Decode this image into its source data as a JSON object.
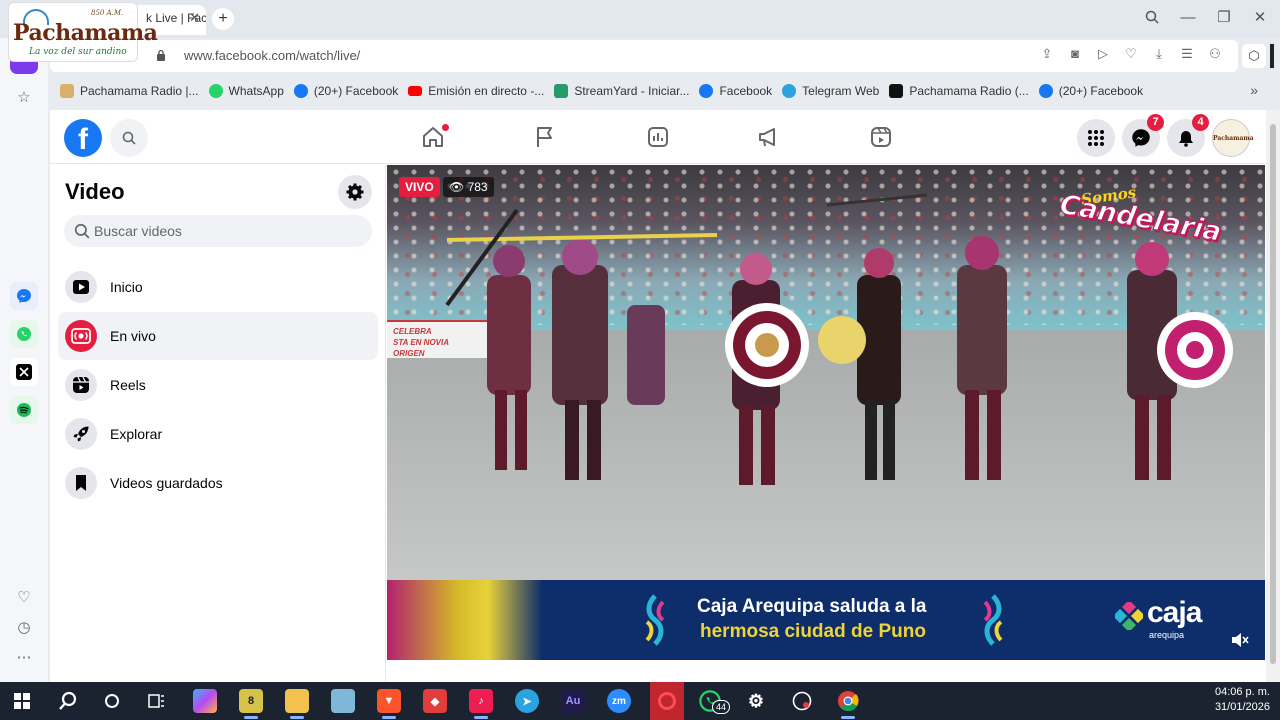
{
  "browser": {
    "tab_title": "k Live | Faceb",
    "url": "www.facebook.com/watch/live/",
    "bookmarks": [
      {
        "label": "Pachamama Radio |...",
        "icon": "pachamama-icon",
        "color": "#d8b06a"
      },
      {
        "label": "WhatsApp",
        "icon": "whatsapp-icon",
        "color": "#25d366"
      },
      {
        "label": "(20+) Facebook",
        "icon": "facebook-icon",
        "color": "#1877f2"
      },
      {
        "label": "Emisión en directo -...",
        "icon": "youtube-icon",
        "color": "#ff0000"
      },
      {
        "label": "StreamYard - Iniciar...",
        "icon": "streamyard-icon",
        "color": "#2b9a6a"
      },
      {
        "label": "Facebook",
        "icon": "facebook-icon",
        "color": "#1877f2"
      },
      {
        "label": "Telegram Web",
        "icon": "telegram-icon",
        "color": "#2aa3df"
      },
      {
        "label": "Pachamama Radio (...",
        "icon": "tiktok-icon",
        "color": "#111111"
      },
      {
        "label": "(20+) Facebook",
        "icon": "facebook-icon",
        "color": "#1877f2"
      }
    ]
  },
  "logo": {
    "freq": "850 A.M.",
    "name": "Pachamama",
    "tagline": "La voz del sur andino"
  },
  "facebook": {
    "messenger_badge": "7",
    "notifications_badge": "4",
    "avatar_text": "Pachamama",
    "sidebar": {
      "title": "Video",
      "search_placeholder": "Buscar videos",
      "items": [
        {
          "label": "Inicio",
          "icon": "play-icon",
          "active": false
        },
        {
          "label": "En vivo",
          "icon": "live-icon",
          "active": true
        },
        {
          "label": "Reels",
          "icon": "reels-icon",
          "active": false
        },
        {
          "label": "Explorar",
          "icon": "rocket-icon",
          "active": false
        },
        {
          "label": "Videos guardados",
          "icon": "bookmark-icon",
          "active": false
        }
      ]
    },
    "video": {
      "live_label": "VIVO",
      "viewers": "783",
      "overlay_small": "Somos",
      "overlay_big": "Candelaria",
      "wall_text": "CELEBRA\nSTA EN NOVIA\nORIGEN",
      "ad_line1": "Caja Arequipa saluda a la",
      "ad_line2": "hermosa ciudad de Puno",
      "ad_brand": "caja",
      "ad_brand_sub": "arequipa"
    }
  },
  "taskbar": {
    "time": "04:06 p. m.",
    "date": "31/01/2026",
    "whatsapp_count": "44"
  },
  "colors": {
    "facebook_blue": "#1877f2",
    "live_red": "#e41e3f",
    "ad_navy": "#0e2d6b",
    "ad_yellow": "#f0d336"
  }
}
